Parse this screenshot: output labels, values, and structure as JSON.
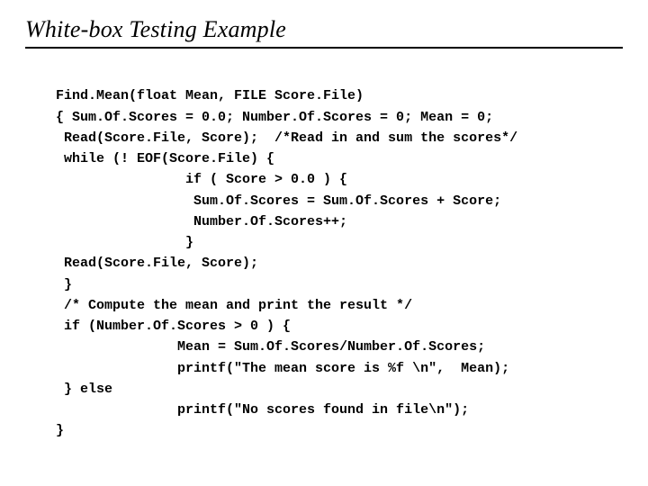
{
  "title": "White-box Testing Example",
  "code": {
    "l0": "Find.Mean(float Mean, FILE Score.File)",
    "l1": "{ Sum.Of.Scores = 0.0; Number.Of.Scores = 0; Mean = 0;",
    "l2": " Read(Score.File, Score);  /*Read in and sum the scores*/",
    "l3": " while (! EOF(Score.File) {",
    "l4": "                if ( Score > 0.0 ) {",
    "l5": "                 Sum.Of.Scores = Sum.Of.Scores + Score;",
    "l6": "                 Number.Of.Scores++;",
    "l7": "                }",
    "l8": " Read(Score.File, Score);",
    "l9": " }",
    "l10": " /* Compute the mean and print the result */",
    "l11": " if (Number.Of.Scores > 0 ) {",
    "l12": "               Mean = Sum.Of.Scores/Number.Of.Scores;",
    "l13": "               printf(\"The mean score is %f \\n\",  Mean);",
    "l14": " } else",
    "l15": "               printf(\"No scores found in file\\n\");",
    "l16": "}"
  }
}
